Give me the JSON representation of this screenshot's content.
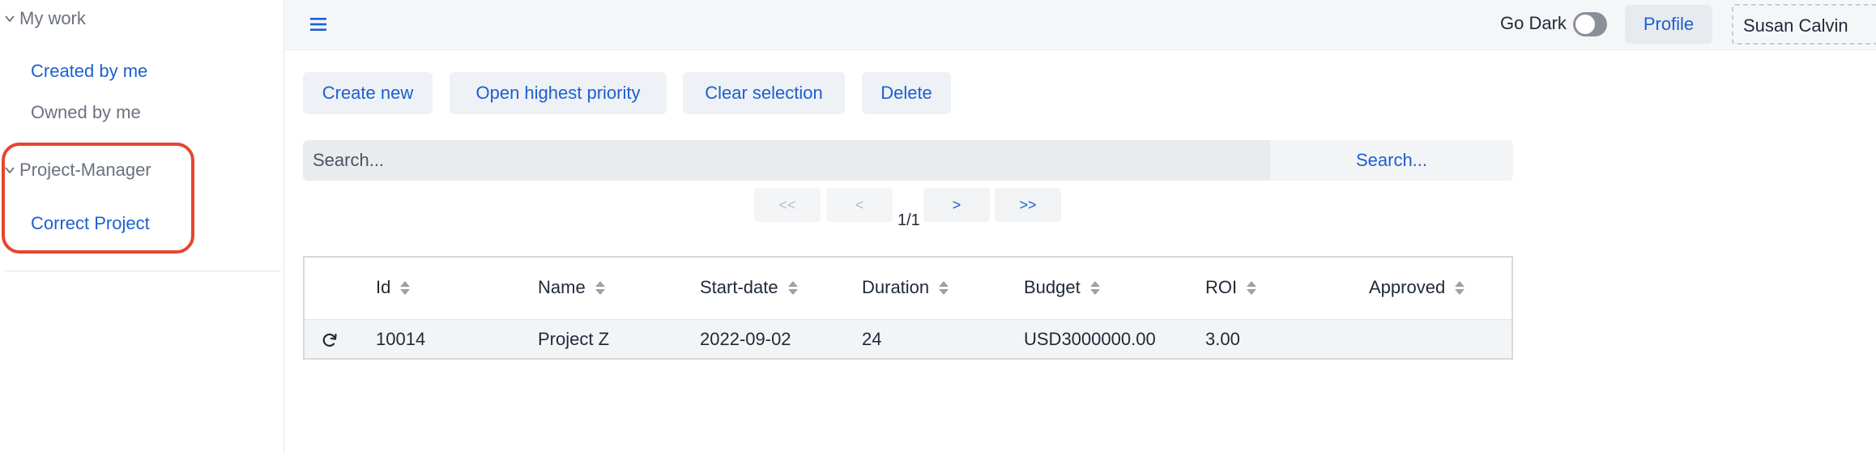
{
  "sidebar": {
    "groups": [
      {
        "label": "My work",
        "items": [
          "Created by me",
          "Owned by me"
        ]
      },
      {
        "label": "Project-Manager",
        "items": [
          "Correct Project"
        ]
      }
    ]
  },
  "topbar": {
    "go_dark_label": "Go Dark",
    "dark_mode_on": false,
    "profile_label": "Profile",
    "user_name": "Susan Calvin"
  },
  "toolbar": {
    "create_new": "Create new",
    "open_highest_priority": "Open highest priority",
    "clear_selection": "Clear selection",
    "delete": "Delete"
  },
  "search": {
    "placeholder": "Search...",
    "button_label": "Search..."
  },
  "pagination": {
    "first": "<<",
    "prev": "<",
    "next": ">",
    "last": ">>",
    "indicator": "1/1"
  },
  "table": {
    "columns": [
      "Id",
      "Name",
      "Start-date",
      "Duration",
      "Budget",
      "ROI",
      "Approved"
    ],
    "rows": [
      {
        "id": "10014",
        "name": "Project Z",
        "start_date": "2022-09-02",
        "duration": "24",
        "budget": "USD3000000.00",
        "roi": "3.00",
        "approved": ""
      }
    ]
  },
  "colors": {
    "link_blue": "#1d5fd0",
    "highlight_red": "#e5462f"
  }
}
